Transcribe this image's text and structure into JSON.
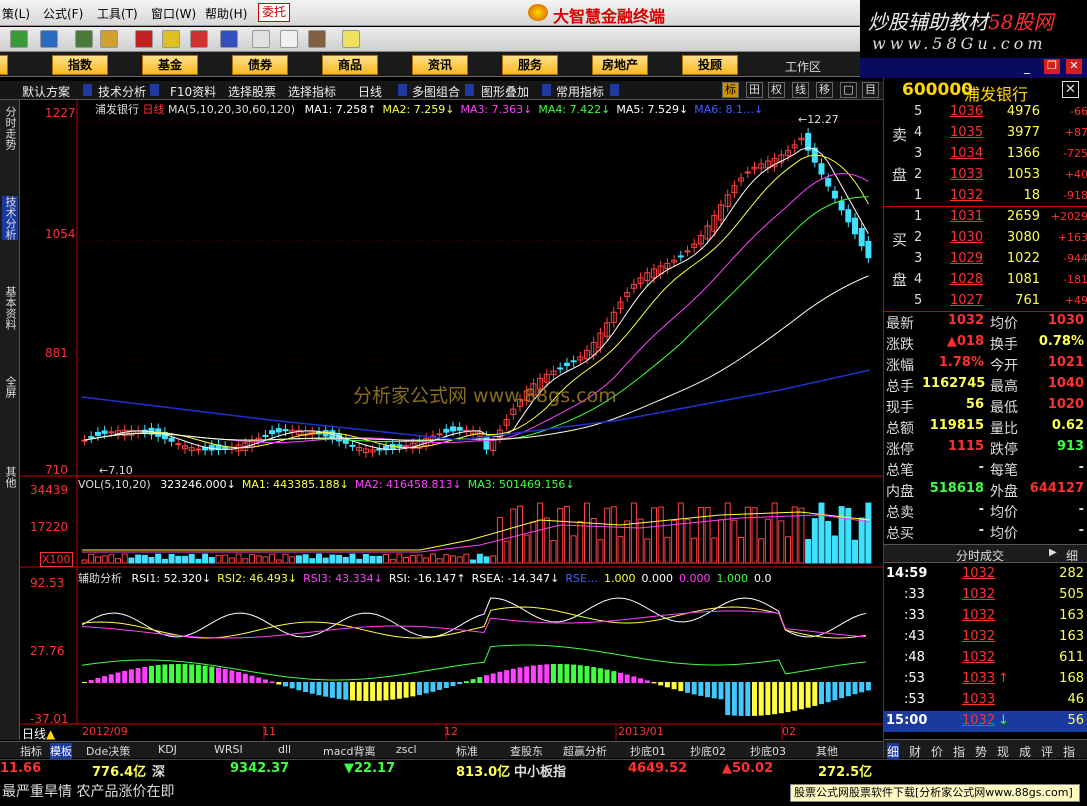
{
  "menu": {
    "items": [
      "策(L)",
      "公式(F)",
      "工具(T)",
      "窗口(W)",
      "帮助(H)"
    ],
    "entrust": "委托",
    "app_title": "大智慧金融终端",
    "watermark_line1_a": "炒股辅助教材",
    "watermark_line1_b": "58股网",
    "watermark_line2": "www.58Gu.com"
  },
  "categories": [
    "指数",
    "基金",
    "债券",
    "商品",
    "资讯",
    "服务",
    "房地产",
    "投顾"
  ],
  "workarea": "工作区",
  "strip": {
    "items": [
      "默认方案",
      "技术分析",
      "F10资料",
      "选择股票",
      "选择指标",
      "日线",
      "多图组合",
      "图形叠加",
      "常用指标"
    ],
    "boxes": [
      "标",
      "田",
      "权",
      "线",
      "移",
      "□",
      "目"
    ]
  },
  "side_tabs": [
    "分时走势",
    "技术分析",
    "基本资料",
    "全屏",
    "其他"
  ],
  "price_panel": {
    "name": "浦发银行",
    "period": "日线",
    "ma_header": "MA(5,10,20,30,60,120)",
    "ma": [
      {
        "label": "MA1: 7.258↑",
        "color": "#ffffff"
      },
      {
        "label": "MA2: 7.259↓",
        "color": "#ffff40"
      },
      {
        "label": "MA3: 7.363↓",
        "color": "#ff40ff"
      },
      {
        "label": "MA4: 7.422↓",
        "color": "#40ff40"
      },
      {
        "label": "MA5: 7.529↓",
        "color": "#ffffff"
      },
      {
        "label": "MA6: 8.1…↓",
        "color": "#4060ff"
      }
    ],
    "y_labels": [
      "1227",
      "1054",
      "881",
      "710"
    ],
    "high_label": "12.27",
    "low_label": "7.10",
    "watermark": "分析家公式网 www.88gs.com"
  },
  "vol_panel": {
    "header": "VOL(5,10,20)",
    "values": [
      {
        "label": "323246.000↓",
        "color": "#ffffff"
      },
      {
        "label": "MA1: 443385.188↓",
        "color": "#ffff40"
      },
      {
        "label": "MA2: 416458.813↓",
        "color": "#ff40ff"
      },
      {
        "label": "MA3: 501469.156↓",
        "color": "#40ff40"
      }
    ],
    "y_labels": [
      "34439",
      "17220",
      "X100"
    ]
  },
  "aux_panel": {
    "header": "辅助分析",
    "values": [
      {
        "label": "RSI1: 52.320↓",
        "color": "#ffffff"
      },
      {
        "label": "RSI2: 46.493↓",
        "color": "#ffff40"
      },
      {
        "label": "RSI3: 43.334↓",
        "color": "#ff40ff"
      },
      {
        "label": "RSI: -16.147↑",
        "color": "#ffffff"
      },
      {
        "label": "RSEA: -14.347↓",
        "color": "#ffffff"
      },
      {
        "label": "RSE…",
        "color": "#4060ff"
      },
      {
        "label": "1.000",
        "color": "#ffff40"
      },
      {
        "label": "0.000",
        "color": "#ffffff"
      },
      {
        "label": "0.000",
        "color": "#ff40ff"
      },
      {
        "label": "1.000",
        "color": "#40ff40"
      },
      {
        "label": "0.0",
        "color": "#ffffff"
      }
    ],
    "y_labels": [
      "92.53",
      "27.76",
      "-37.01"
    ]
  },
  "x_axis": [
    "2012/09",
    "11",
    "12",
    "2013/01",
    "02"
  ],
  "period_label": "日线",
  "bottom_tabs": [
    "指标",
    "模板",
    "Dde决策",
    "KDJ",
    "WRSI",
    "dll",
    "macd背离",
    "zscl",
    "标准",
    "查股东",
    "超赢分析",
    "抄底01",
    "抄底02",
    "抄底03",
    "其他"
  ],
  "stock": {
    "code": "600000",
    "name": "浦发银行"
  },
  "sell_label": [
    "卖",
    "盘"
  ],
  "buy_label": [
    "买",
    "盘"
  ],
  "asks": [
    {
      "n": "5",
      "p": "1036",
      "v": "4976",
      "c": "-66"
    },
    {
      "n": "4",
      "p": "1035",
      "v": "3977",
      "c": "+87"
    },
    {
      "n": "3",
      "p": "1034",
      "v": "1366",
      "c": "-725"
    },
    {
      "n": "2",
      "p": "1033",
      "v": "1053",
      "c": "+40"
    },
    {
      "n": "1",
      "p": "1032",
      "v": "18",
      "c": "-918"
    }
  ],
  "bids": [
    {
      "n": "1",
      "p": "1031",
      "v": "2659",
      "c": "+2029"
    },
    {
      "n": "2",
      "p": "1030",
      "v": "3080",
      "c": "+163"
    },
    {
      "n": "3",
      "p": "1029",
      "v": "1022",
      "c": "-944"
    },
    {
      "n": "4",
      "p": "1028",
      "v": "1081",
      "c": "-181"
    },
    {
      "n": "5",
      "p": "1027",
      "v": "761",
      "c": "+49"
    }
  ],
  "quote": [
    {
      "l": "最新",
      "v": "1032",
      "l2": "均价",
      "v2": "1030",
      "c1": "#ff3030",
      "c2": "#ff3030"
    },
    {
      "l": "涨跌",
      "v": "▲018",
      "l2": "换手",
      "v2": "0.78%",
      "c1": "#ff3030",
      "c2": "#ffff50"
    },
    {
      "l": "涨幅",
      "v": "1.78%",
      "l2": "今开",
      "v2": "1021",
      "c1": "#ff3030",
      "c2": "#ff3030"
    },
    {
      "l": "总手",
      "v": "1162745",
      "l2": "最高",
      "v2": "1040",
      "c1": "#ffff50",
      "c2": "#ff3030"
    },
    {
      "l": "现手",
      "v": "56",
      "l2": "最低",
      "v2": "1020",
      "c1": "#ffff50",
      "c2": "#ff3030"
    },
    {
      "l": "总额",
      "v": "119815",
      "l2": "量比",
      "v2": "0.62",
      "c1": "#ffff50",
      "c2": "#ffff50"
    },
    {
      "l": "涨停",
      "v": "1115",
      "l2": "跌停",
      "v2": "913",
      "c1": "#ff3030",
      "c2": "#40ff40"
    },
    {
      "l": "总笔",
      "v": "-",
      "l2": "每笔",
      "v2": "-",
      "c1": "#ddd",
      "c2": "#ddd"
    },
    {
      "l": "内盘",
      "v": "518618",
      "l2": "外盘",
      "v2": "644127",
      "c1": "#40ff40",
      "c2": "#ff3030"
    },
    {
      "l": "总卖",
      "v": "-",
      "l2": "均价",
      "v2": "-",
      "c1": "#ddd",
      "c2": "#ddd"
    },
    {
      "l": "总买",
      "v": "-",
      "l2": "均价",
      "v2": "-",
      "c1": "#ddd",
      "c2": "#ddd"
    }
  ],
  "trades_header": "分时成交",
  "trades_btn": "细",
  "trades": [
    {
      "t": "14:59",
      "p": "1032",
      "v": "282",
      "a": ""
    },
    {
      "t": ":33",
      "p": "1032",
      "v": "505",
      "a": ""
    },
    {
      "t": ":33",
      "p": "1032",
      "v": "163",
      "a": ""
    },
    {
      "t": ":43",
      "p": "1032",
      "v": "163",
      "a": ""
    },
    {
      "t": ":48",
      "p": "1032",
      "v": "611",
      "a": ""
    },
    {
      "t": ":53",
      "p": "1033",
      "v": "168",
      "a": "↑"
    },
    {
      "t": ":53",
      "p": "1033",
      "v": "46",
      "a": ""
    },
    {
      "t": "15:00",
      "p": "1032",
      "v": "56",
      "a": "↓"
    }
  ],
  "right_tabs": [
    "细",
    "财",
    "价",
    "指",
    "势",
    "现",
    "成",
    "评",
    "指"
  ],
  "ticker1": [
    {
      "v": "11.66",
      "c": "#ff3030"
    },
    {
      "v": "776.4亿",
      "c": "#ffff50"
    },
    {
      "v": "深",
      "c": "#ddd"
    },
    {
      "v": "9342.37",
      "c": "#40ff40"
    },
    {
      "v": "▼22.17",
      "c": "#40ff40"
    },
    {
      "v": "813.0亿",
      "c": "#ffff50"
    },
    {
      "v": "中小板指",
      "c": "#ddd"
    },
    {
      "v": "4649.52",
      "c": "#ff3030"
    },
    {
      "v": "▲50.02",
      "c": "#ff3030"
    },
    {
      "v": "272.5亿",
      "c": "#ffff50"
    }
  ],
  "news": "最严重旱情 农产品涨价在即",
  "promo": "股票公式网股票软件下载[分析家公式网www.88gs.com]"
}
